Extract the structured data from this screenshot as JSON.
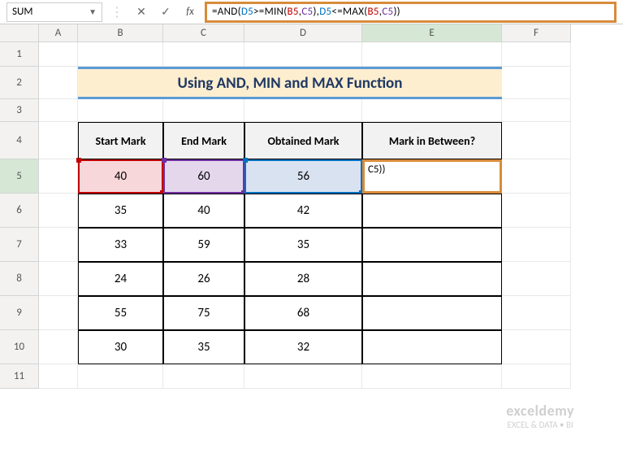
{
  "nameBox": "SUM",
  "formula": {
    "parts": [
      {
        "t": "=AND(",
        "c": "t-black"
      },
      {
        "t": "D5",
        "c": "t-blue"
      },
      {
        "t": ">=MIN(",
        "c": "t-black"
      },
      {
        "t": "B5",
        "c": "t-red"
      },
      {
        "t": ",",
        "c": "t-black"
      },
      {
        "t": "C5",
        "c": "t-purple"
      },
      {
        "t": "),",
        "c": "t-black"
      },
      {
        "t": "D5",
        "c": "t-blue"
      },
      {
        "t": "<=MAX(",
        "c": "t-black"
      },
      {
        "t": "B5",
        "c": "t-red"
      },
      {
        "t": ",",
        "c": "t-black"
      },
      {
        "t": "C5",
        "c": "t-purple"
      },
      {
        "t": "))",
        "c": "t-black"
      }
    ]
  },
  "columns": [
    "A",
    "B",
    "C",
    "D",
    "E",
    "F"
  ],
  "rows": [
    "1",
    "2",
    "3",
    "4",
    "5",
    "6",
    "7",
    "8",
    "9",
    "10",
    "11"
  ],
  "title": "Using AND, MIN and MAX Function",
  "headers": {
    "b4": "Start Mark",
    "c4": "End Mark",
    "d4": "Obtained Mark",
    "e4": "Mark in Between?"
  },
  "e5_display": "C5))",
  "chart_data": {
    "type": "table",
    "columns": [
      "Start Mark",
      "End Mark",
      "Obtained Mark",
      "Mark in Between?"
    ],
    "rows": [
      {
        "start": 40,
        "end": 60,
        "obtained": 56,
        "between": ""
      },
      {
        "start": 35,
        "end": 40,
        "obtained": 42,
        "between": ""
      },
      {
        "start": 33,
        "end": 59,
        "obtained": 35,
        "between": ""
      },
      {
        "start": 24,
        "end": 26,
        "obtained": 28,
        "between": ""
      },
      {
        "start": 55,
        "end": 75,
        "obtained": 68,
        "between": ""
      },
      {
        "start": 30,
        "end": 35,
        "obtained": 32,
        "between": ""
      }
    ]
  },
  "watermark": {
    "brand": "exceldemy",
    "tagline": "EXCEL & DATA • BI"
  }
}
